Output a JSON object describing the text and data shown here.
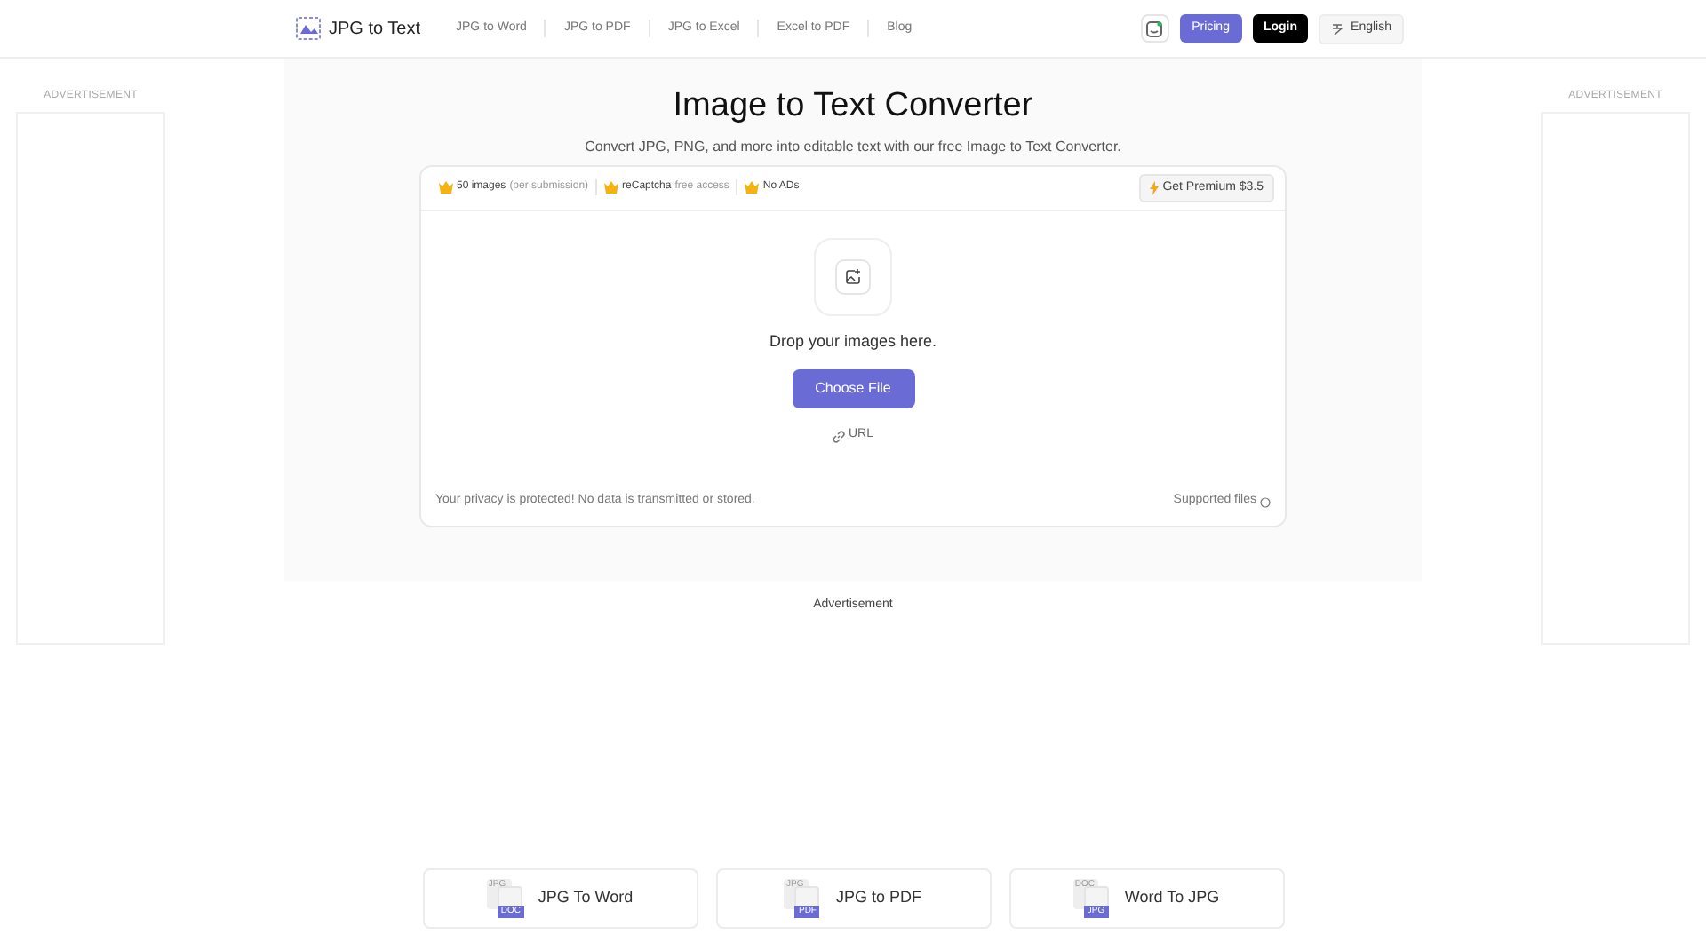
{
  "header": {
    "logo": "JPG to Text",
    "nav": [
      "JPG to Word",
      "JPG to PDF",
      "JPG to Excel",
      "Excel to PDF",
      "Blog"
    ],
    "pricing": "Pricing",
    "login": "Login",
    "language": "English"
  },
  "ads": {
    "left": "ADVERTISEMENT",
    "right": "ADVERTISEMENT",
    "bottom": "Advertisement"
  },
  "hero": {
    "title": "Image to Text Converter",
    "subtitle": "Convert JPG, PNG, and more into editable text with our free Image to Text Converter."
  },
  "features": [
    {
      "label": "50 images",
      "note": "(per submission)"
    },
    {
      "label": "reCaptcha",
      "note": "free access"
    },
    {
      "label": "No ADs"
    }
  ],
  "premium": "Get Premium $3.5",
  "upload": {
    "drop": "Drop your images here.",
    "button": "Choose File",
    "url": "URL",
    "privacy": "Your privacy is protected! No data is transmitted or stored.",
    "supported": "Supported files"
  },
  "tools": [
    {
      "label": "JPG To Word",
      "from": "JPG",
      "to": "DOC"
    },
    {
      "label": "JPG to PDF",
      "from": "JPG",
      "to": "PDF"
    },
    {
      "label": "Word To JPG",
      "from": "DOC",
      "to": "JPG"
    }
  ]
}
